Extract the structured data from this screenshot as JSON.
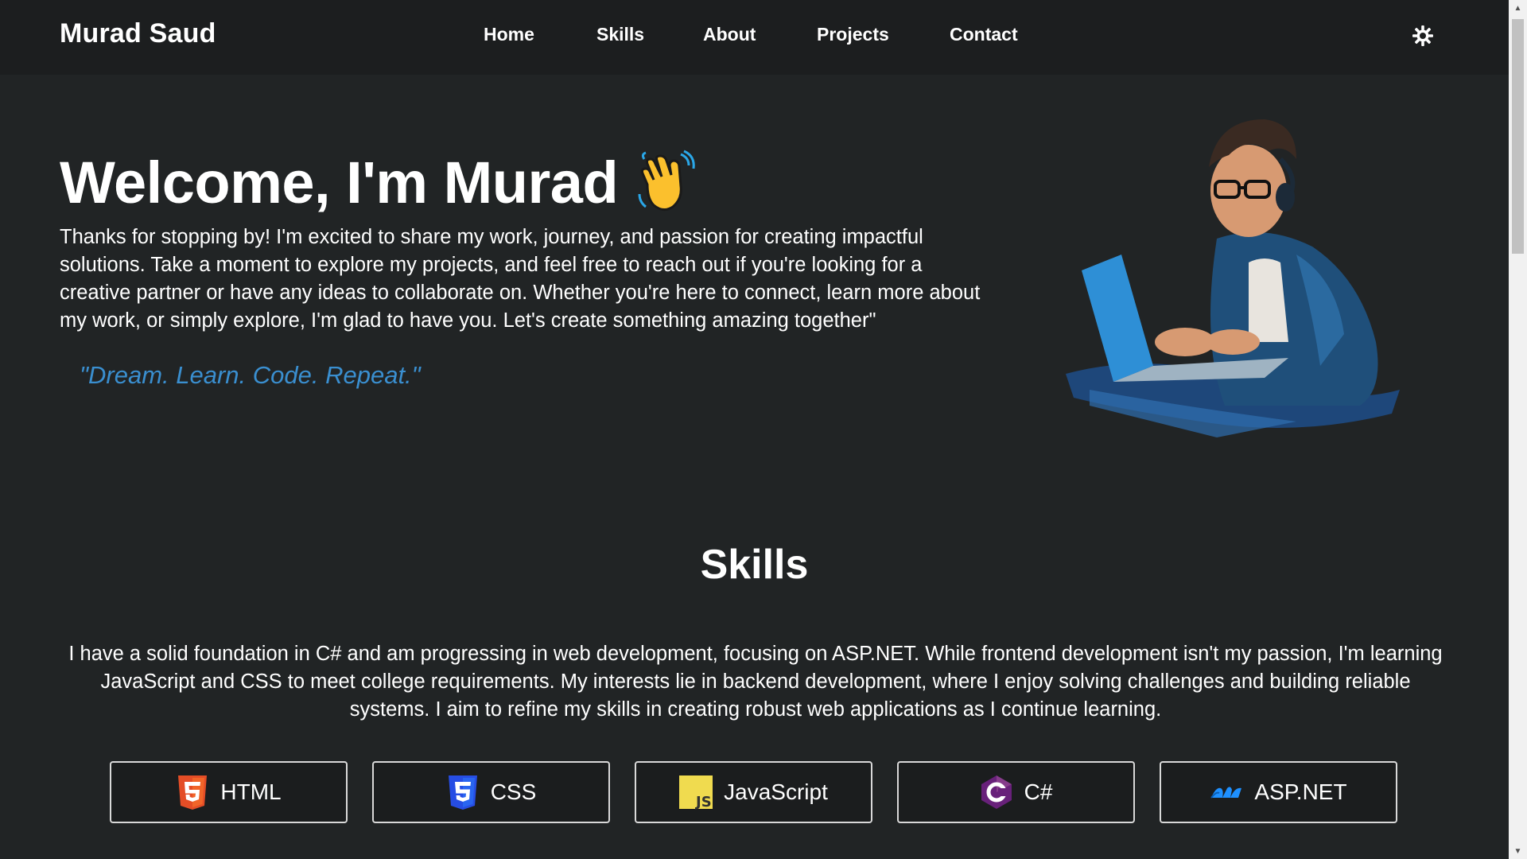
{
  "navbar": {
    "brand": "Murad Saud",
    "links": [
      "Home",
      "Skills",
      "About",
      "Projects",
      "Contact"
    ],
    "theme_toggle_icon": "sun-gear-icon"
  },
  "hero": {
    "title": "Welcome, I'm Murad",
    "title_icon": "waving-hand-icon",
    "intro": "Thanks for stopping by! I'm excited to share my work, journey, and passion for creating impactful solutions. Take a moment to explore my projects, and feel free to reach out if you're looking for a creative partner or have any ideas to collaborate on. Whether you're here to connect, learn more about my work, or simply explore, I'm glad to have you. Let's create something amazing together\"",
    "tagline": "\"Dream. Learn. Code. Repeat.\"",
    "illustration": "developer-with-laptop-illustration"
  },
  "skills": {
    "heading": "Skills",
    "description": "I have a solid foundation in C# and am progressing in web development, focusing on ASP.NET. While frontend development isn't my passion, I'm learning JavaScript and CSS to meet college requirements. My interests lie in backend development, where I enjoy solving challenges and building reliable systems. I aim to refine my skills in creating robust web applications as I continue learning.",
    "items": [
      {
        "label": "HTML",
        "icon": "html5-icon",
        "color": "#e44d26"
      },
      {
        "label": "CSS",
        "icon": "css3-icon",
        "color": "#264de4"
      },
      {
        "label": "JavaScript",
        "icon": "javascript-icon",
        "color": "#f0db4f"
      },
      {
        "label": "C#",
        "icon": "csharp-icon",
        "color": "#68217a"
      },
      {
        "label": "ASP.NET",
        "icon": "aspnet-icon",
        "color": "#1e90ff"
      }
    ]
  },
  "colors": {
    "background": "#212425",
    "navbar": "#1c1e1f",
    "accent": "#3a8fd0"
  }
}
